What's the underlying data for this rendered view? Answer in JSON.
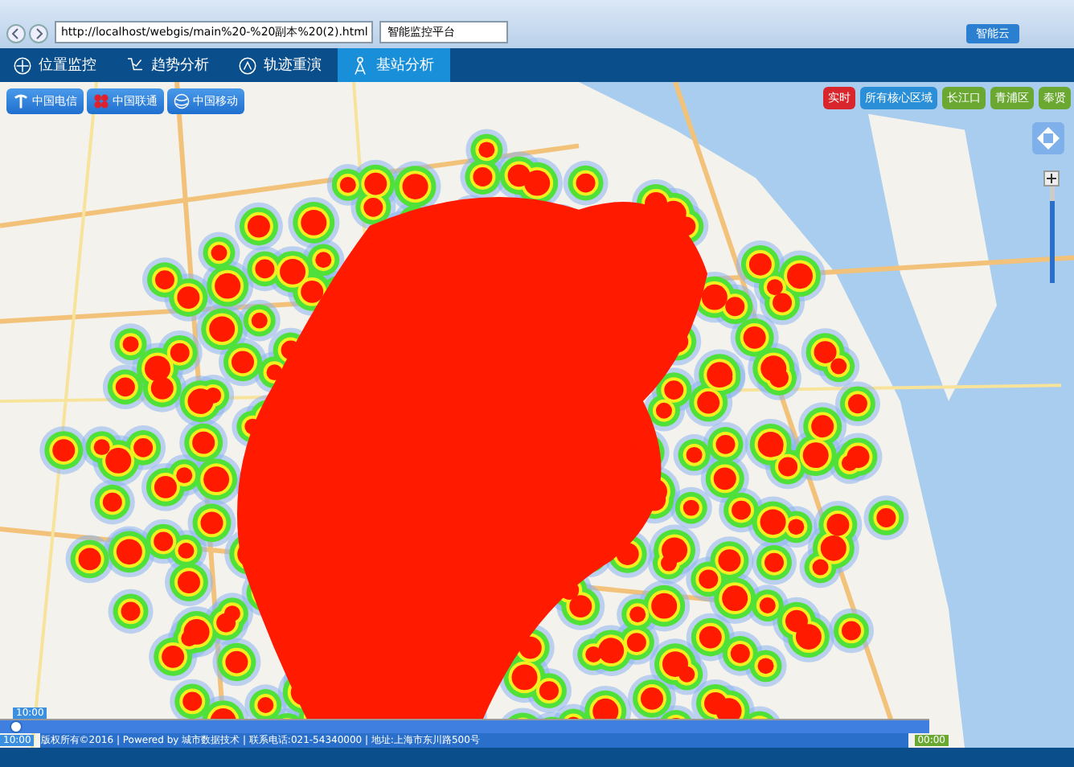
{
  "browser": {
    "url": "http://localhost/webgis/main%20-%20副本%20(2).html",
    "tab_title": "智能监控平台",
    "badge": "智能云"
  },
  "nav": [
    {
      "label": "位置监控",
      "selected": false
    },
    {
      "label": "趋势分析",
      "selected": false
    },
    {
      "label": "轨迹重演",
      "selected": false
    },
    {
      "label": "基站分析",
      "selected": true
    }
  ],
  "carriers": [
    {
      "label": "中国电信"
    },
    {
      "label": "中国联通"
    },
    {
      "label": "中国移动"
    }
  ],
  "region_buttons": [
    {
      "label": "实时",
      "color": "#d9262c"
    },
    {
      "label": "所有核心区域",
      "color": "#2a8fd6"
    },
    {
      "label": "长江口",
      "color": "#6aa832"
    },
    {
      "label": "青浦区",
      "color": "#6aa832"
    },
    {
      "label": "奉贤",
      "color": "#6aa832"
    }
  ],
  "zoom_slider": {
    "level": 0.85
  },
  "timeline": {
    "start_label": "10:00",
    "current_label": "10:00",
    "end_label": "00:00",
    "level": 0.01
  },
  "status_bar": "版权所有©2016 | Powered by 城市数据技术 | 联系电话:021-54340000 | 地址:上海市东川路500号"
}
